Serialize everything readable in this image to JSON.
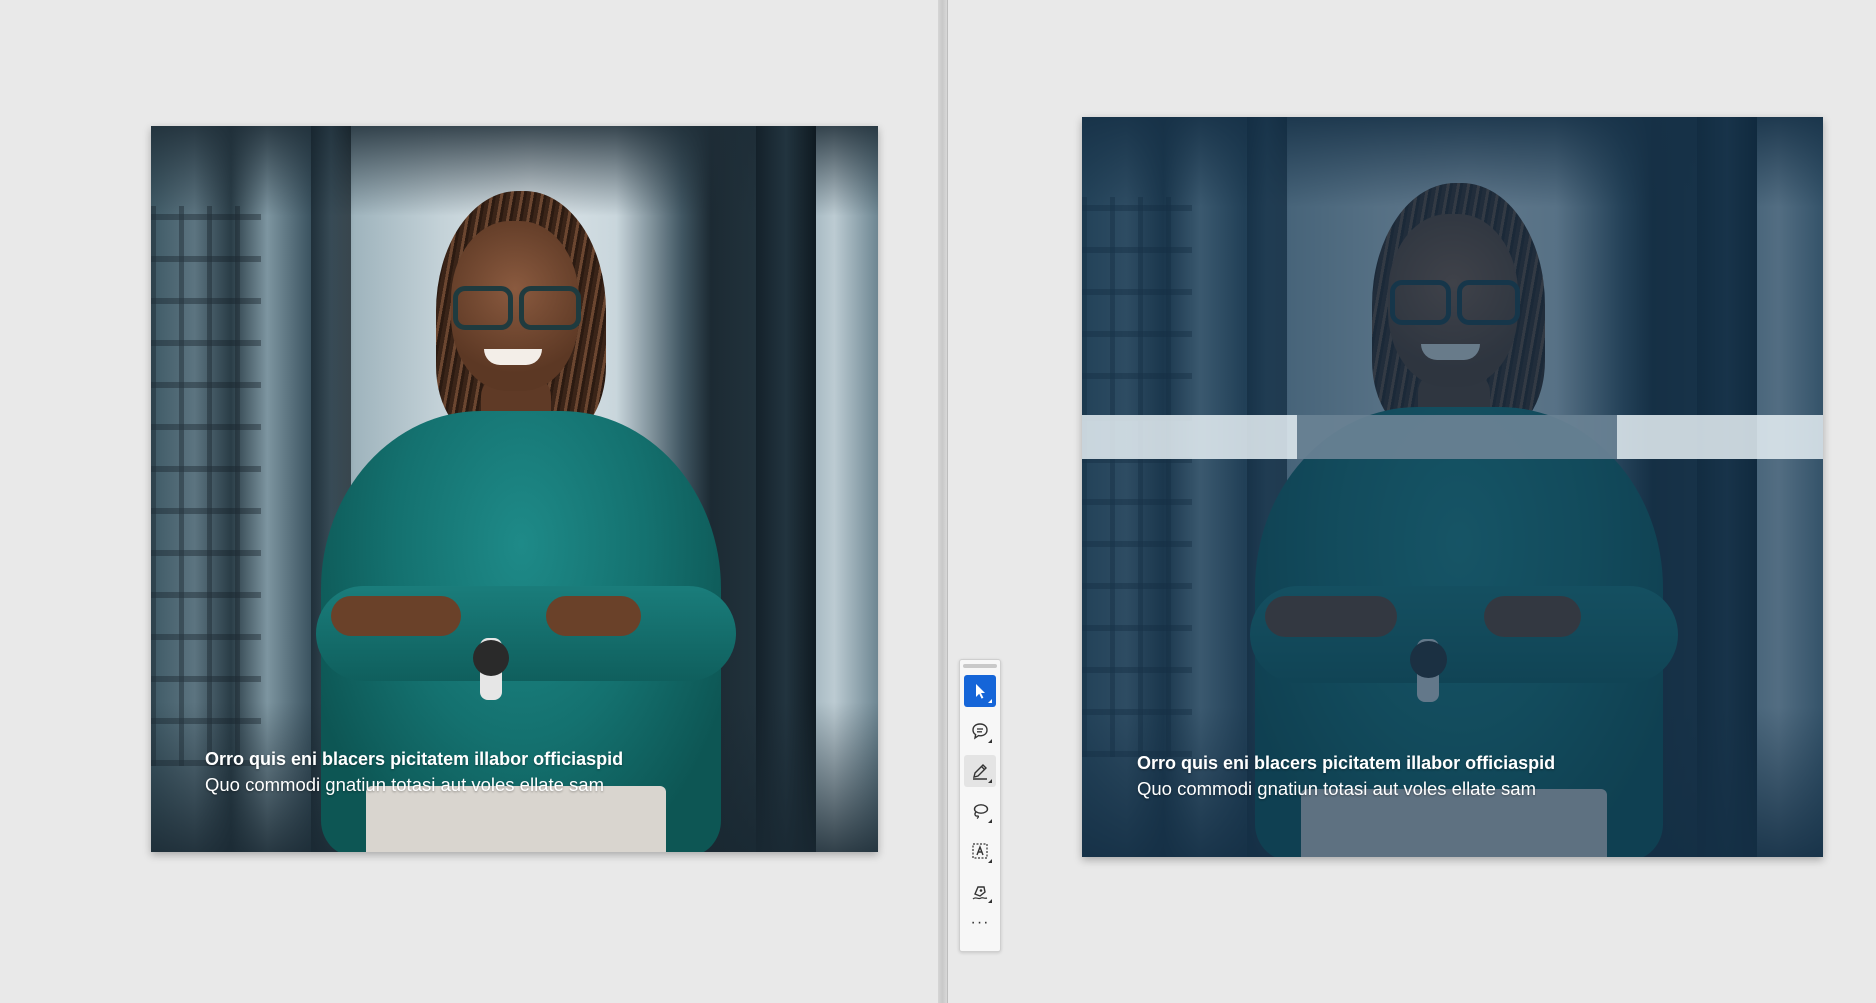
{
  "left_card": {
    "caption_title": "Orro quis eni blacers picitatem illabor officiaspid",
    "caption_subtitle": "Quo commodi gnatiun totasi aut voles ellate sam"
  },
  "right_card": {
    "caption_title": "Orro quis eni blacers picitatem illabor officiaspid",
    "caption_subtitle": "Quo commodi gnatiun totasi aut voles ellate sam",
    "overlay_color": "#123450"
  },
  "toolbar": {
    "active_color": "#1565d8",
    "tools": [
      {
        "name": "select-tool",
        "icon": "arrow-pointer-icon",
        "state": "active"
      },
      {
        "name": "comment-tool",
        "icon": "comment-icon",
        "state": "normal"
      },
      {
        "name": "highlight-tool",
        "icon": "pen-icon",
        "state": "hover"
      },
      {
        "name": "lasso-tool",
        "icon": "lasso-icon",
        "state": "normal"
      },
      {
        "name": "text-select-tool",
        "icon": "text-box-icon",
        "state": "normal"
      },
      {
        "name": "sign-tool",
        "icon": "sign-pen-icon",
        "state": "normal"
      }
    ],
    "more_label": "···"
  }
}
